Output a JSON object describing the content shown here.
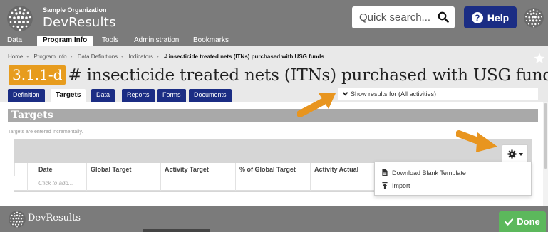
{
  "header": {
    "org_name": "Sample Organization",
    "brand": "DevResults",
    "search_placeholder": "Quick search...",
    "help_label": "Help",
    "help_icon_glyph": "?"
  },
  "nav": {
    "items": [
      "Data",
      "Program Info",
      "Tools",
      "Administration",
      "Bookmarks"
    ],
    "active": "Program Info"
  },
  "breadcrumb": {
    "items": [
      "Home",
      "Program Info",
      "Data Definitions",
      "Indicators"
    ],
    "current": "# insecticide treated nets (ITNs) purchased with USG funds"
  },
  "title": {
    "code": "3.1.1-d",
    "text": "# insecticide treated nets (ITNs) purchased with USG funds"
  },
  "tabs": {
    "items": [
      "Definition",
      "Targets",
      "Data",
      "Reports",
      "Forms",
      "Documents"
    ],
    "active": "Targets"
  },
  "show_results": "Show results for (All activities)",
  "section": {
    "title": "Targets",
    "note": "Targets are entered incrementally."
  },
  "table": {
    "columns": [
      "Date",
      "Global Target",
      "Activity Target",
      "% of Global Target",
      "Activity Actual"
    ],
    "row_placeholder": "Click to add..."
  },
  "dropdown": {
    "items": [
      "Download Blank Template",
      "Import"
    ]
  },
  "footer": {
    "brand": "DevResults",
    "done_label": "Done"
  },
  "icons": {
    "logo": "globe-icon",
    "search": "search-icon",
    "help": "question-circle-icon",
    "favorite": "star-icon",
    "results_toggle": "chevron-down-icon",
    "settings": "gear-icon",
    "download": "file-icon",
    "import": "upload-icon",
    "done": "check-icon"
  },
  "colors": {
    "chrome": "#7b7b7b",
    "navy": "#1b2d84",
    "badge": "#e79c1e",
    "done": "#5cb85c",
    "annotation": "#e8951f"
  }
}
